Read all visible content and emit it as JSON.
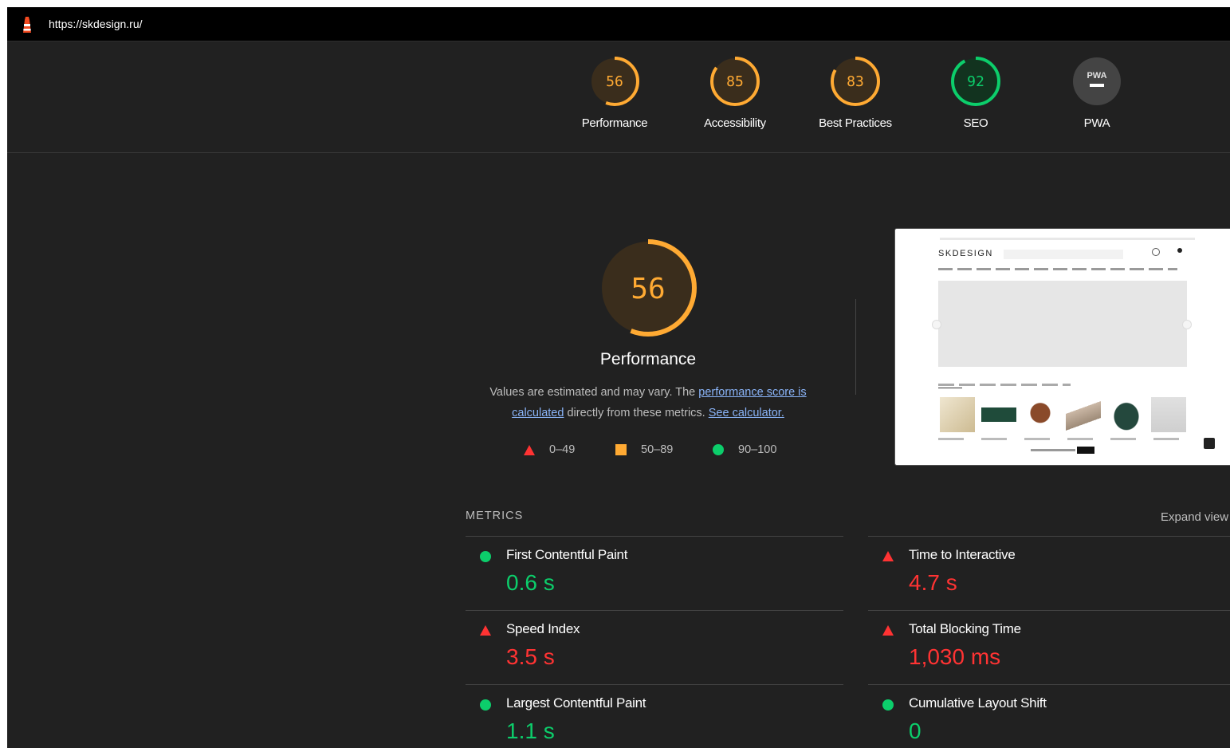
{
  "url": "https://skdesign.ru/",
  "colors": {
    "fail": "#ff3333",
    "average": "#ffaa33",
    "pass": "#0cce6b",
    "pwa": "#e0e0e0"
  },
  "categories": [
    {
      "score": "56",
      "label": "Performance",
      "status": "average",
      "value": 0.56
    },
    {
      "score": "85",
      "label": "Accessibility",
      "status": "average",
      "value": 0.85
    },
    {
      "score": "83",
      "label": "Best Practices",
      "status": "average",
      "value": 0.83
    },
    {
      "score": "92",
      "label": "SEO",
      "status": "pass",
      "value": 0.92
    },
    {
      "score": "PWA",
      "label": "PWA",
      "status": "pwa",
      "value": 0
    }
  ],
  "performance": {
    "score": "56",
    "value": 0.56,
    "title": "Performance",
    "desc_1": "Values are estimated and may vary. The ",
    "link_1": "performance score is calculated",
    "desc_2": " directly from these metrics. ",
    "link_2": "See calculator."
  },
  "legend": [
    {
      "range": "0–49",
      "symbol": "triangle"
    },
    {
      "range": "50–89",
      "symbol": "square"
    },
    {
      "range": "90–100",
      "symbol": "circle"
    }
  ],
  "thumbnail": {
    "logo": "SKDESIGN"
  },
  "metrics": {
    "heading": "METRICS",
    "expand": "Expand view",
    "items": [
      {
        "title": "First Contentful Paint",
        "value": "0.6 s",
        "status": "pass"
      },
      {
        "title": "Time to Interactive",
        "value": "4.7 s",
        "status": "fail"
      },
      {
        "title": "Speed Index",
        "value": "3.5 s",
        "status": "fail"
      },
      {
        "title": "Total Blocking Time",
        "value": "1,030 ms",
        "status": "fail"
      },
      {
        "title": "Largest Contentful Paint",
        "value": "1.1 s",
        "status": "pass"
      },
      {
        "title": "Cumulative Layout Shift",
        "value": "0",
        "status": "pass"
      }
    ]
  }
}
